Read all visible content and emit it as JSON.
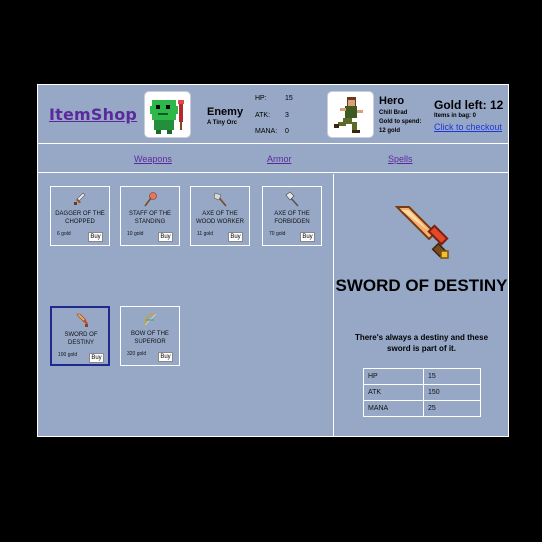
{
  "header": {
    "logo": "ItemShop",
    "enemy": {
      "name": "Enemy",
      "desc": "A Tiny Orc",
      "stats": [
        {
          "label": "HP:",
          "value": "15"
        },
        {
          "label": "ATK:",
          "value": "3"
        },
        {
          "label": "MANA:",
          "value": "0"
        }
      ]
    },
    "hero": {
      "name": "Hero",
      "desc": "Chill Brad",
      "gold_label": "Gold to spend:",
      "gold": "12 gold"
    },
    "gold_left": "Gold left: 12",
    "bag": "Items in bag: 0",
    "checkout": "Click to checkout"
  },
  "nav": [
    "Weapons",
    "Armor",
    "Spells"
  ],
  "items": [
    {
      "name": "DAGGER OF THE CHOPPED",
      "price": "6 gold",
      "buy": "Buy",
      "icon": "dagger-icon"
    },
    {
      "name": "STAFF OF THE STANDING",
      "price": "10 gold",
      "buy": "Buy",
      "icon": "staff-icon"
    },
    {
      "name": "AXE OF THE WOOD WORKER",
      "price": "11 gold",
      "buy": "Buy",
      "icon": "axe-icon"
    },
    {
      "name": "AXE OF THE FORBIDDEN",
      "price": "70 gold",
      "buy": "Buy",
      "icon": "battle-axe-icon"
    },
    {
      "name": "SWORD OF DESTINY",
      "price": "100 gold",
      "buy": "Buy",
      "icon": "sword-icon"
    },
    {
      "name": "BOW OF THE SUPERIOR",
      "price": "320 gold",
      "buy": "Buy",
      "icon": "bow-icon"
    }
  ],
  "detail": {
    "title": "SWORD OF DESTINY",
    "description": "There's always a destiny and these sword is part of it.",
    "stats": [
      {
        "key": "HP",
        "value": "15"
      },
      {
        "key": "ATK",
        "value": "150"
      },
      {
        "key": "MANA",
        "value": "25"
      }
    ]
  }
}
